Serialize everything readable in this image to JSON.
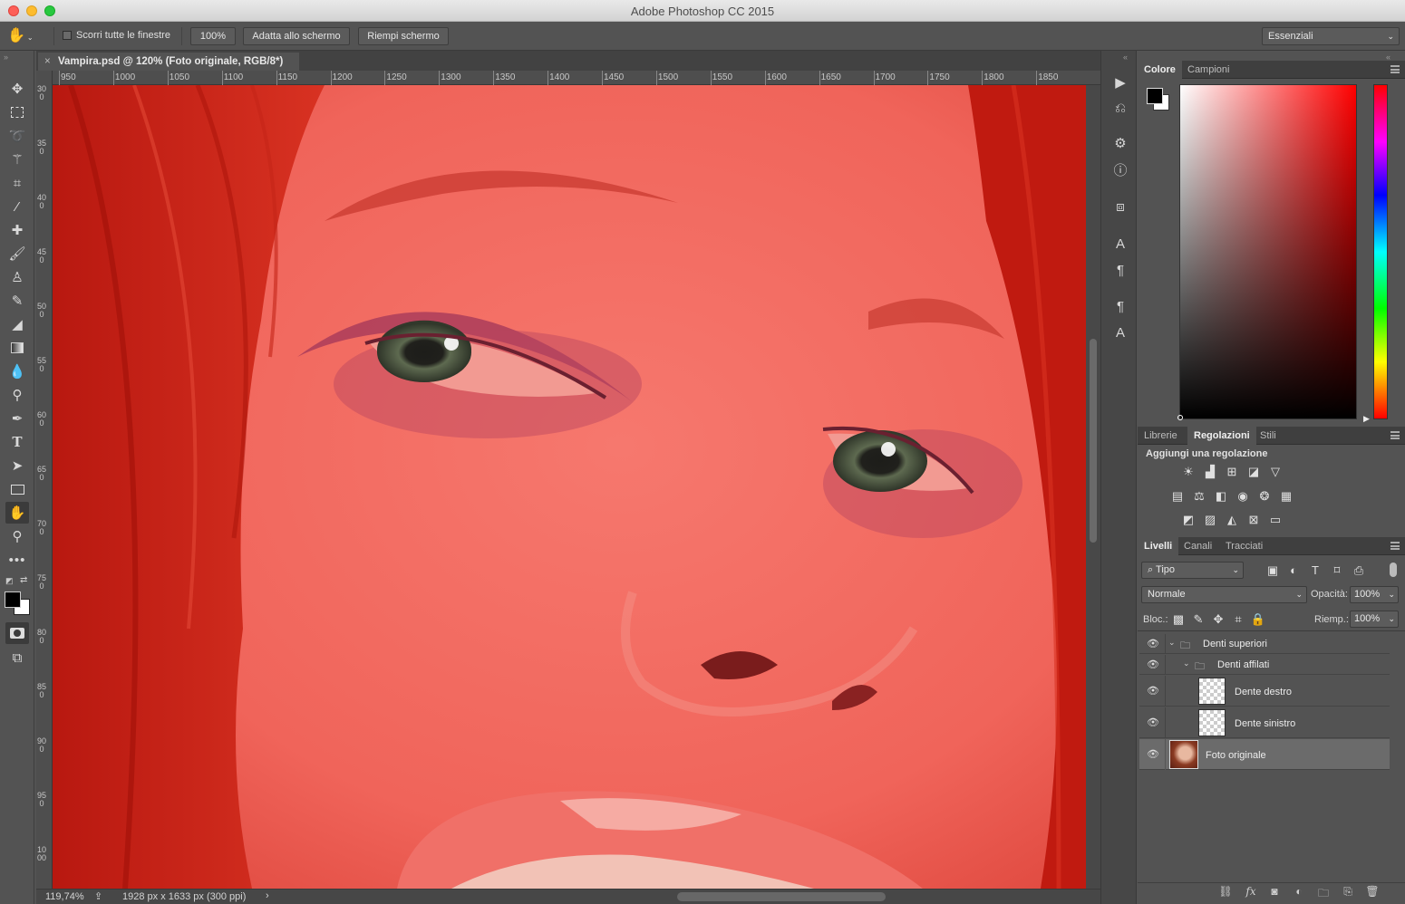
{
  "window": {
    "title": "Adobe Photoshop CC 2015"
  },
  "options_bar": {
    "scroll_all_label": "Scorri tutte le finestre",
    "zoom_100_label": "100%",
    "fit_screen_label": "Adatta allo schermo",
    "fill_screen_label": "Riempi schermo",
    "workspace": "Essenziali"
  },
  "document": {
    "tab_title": "Vampira.psd @ 120% (Foto originale, RGB/8*)"
  },
  "ruler": {
    "h_ticks": [
      "950",
      "1000",
      "1050",
      "1100",
      "1150",
      "1200",
      "1250",
      "1300",
      "1350",
      "1400",
      "1450",
      "1500",
      "1550",
      "1600",
      "1650",
      "1700",
      "1750",
      "1800",
      "1850"
    ],
    "v_ticks": [
      "300",
      "350",
      "400",
      "450",
      "500",
      "550",
      "600",
      "650",
      "700",
      "750",
      "800",
      "850",
      "900",
      "950",
      "1000"
    ]
  },
  "status": {
    "zoom": "119,74%",
    "doc_info": "1928 px x 1633 px (300 ppi)"
  },
  "color_panel": {
    "tabs": [
      "Colore",
      "Campioni"
    ],
    "active": "Colore",
    "foreground": "#000000",
    "background": "#ffffff"
  },
  "adjustments_panel": {
    "tabs": [
      "Librerie",
      "Regolazioni",
      "Stili"
    ],
    "active": "Regolazioni",
    "heading": "Aggiungi una regolazione"
  },
  "layers_panel": {
    "tabs": [
      "Livelli",
      "Canali",
      "Tracciati"
    ],
    "active": "Livelli",
    "filter_kind": "Tipo",
    "blend_mode": "Normale",
    "opacity_label": "Opacità:",
    "opacity": "100%",
    "lock_label": "Bloc.:",
    "fill_label": "Riemp.:",
    "fill": "100%",
    "layers": [
      {
        "name": "Denti superiori",
        "type": "group"
      },
      {
        "name": "Denti affilati",
        "type": "group"
      },
      {
        "name": "Dente destro",
        "type": "layer"
      },
      {
        "name": "Dente sinistro",
        "type": "layer"
      },
      {
        "name": "Foto originale",
        "type": "layer",
        "selected": true
      }
    ]
  },
  "toolbar": {
    "active_tool": "hand-tool"
  }
}
